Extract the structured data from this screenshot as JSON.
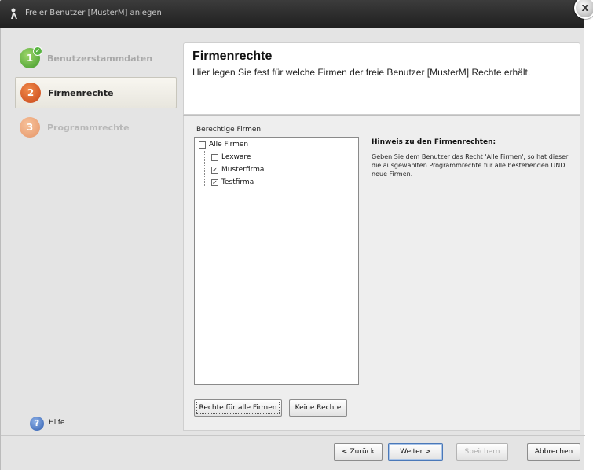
{
  "window": {
    "title": "Freier Benutzer [MusterM] anlegen",
    "close_glyph": "x"
  },
  "steps": [
    {
      "number": "1",
      "label": "Benutzerstammdaten",
      "state": "done",
      "color": "#4caf3a"
    },
    {
      "number": "2",
      "label": "Firmenrechte",
      "state": "current",
      "color": "#d85a22"
    },
    {
      "number": "3",
      "label": "Programmrechte",
      "state": "todo",
      "color": "#eaa57a"
    }
  ],
  "header": {
    "title": "Firmenrechte",
    "subtitle": "Hier legen Sie fest für welche Firmen der freie Benutzer [MusterM] Rechte erhält."
  },
  "firms": {
    "group_label": "Berechtige Firmen",
    "root": {
      "label": "Alle Firmen",
      "checked": false
    },
    "items": [
      {
        "label": "Lexware",
        "checked": false
      },
      {
        "label": "Musterfirma",
        "checked": true
      },
      {
        "label": "Testfirma",
        "checked": true
      }
    ],
    "all_rights_button": "Rechte für alle Firmen",
    "no_rights_button": "Keine Rechte"
  },
  "hint": {
    "title": "Hinweis zu den Firmenrechten:",
    "text": "Geben Sie dem Benutzer das Recht 'Alle Firmen', so hat dieser die ausgewählten Programmrechte für alle bestehenden UND neue Firmen."
  },
  "footer": {
    "help_label": "Hilfe",
    "back_button": "< Zurück",
    "next_button": "Weiter >",
    "save_button": "Speichern",
    "cancel_button": "Abbrechen"
  },
  "icons": {
    "title": "user-icon",
    "help": "help-icon",
    "check": "checkmark-icon"
  }
}
